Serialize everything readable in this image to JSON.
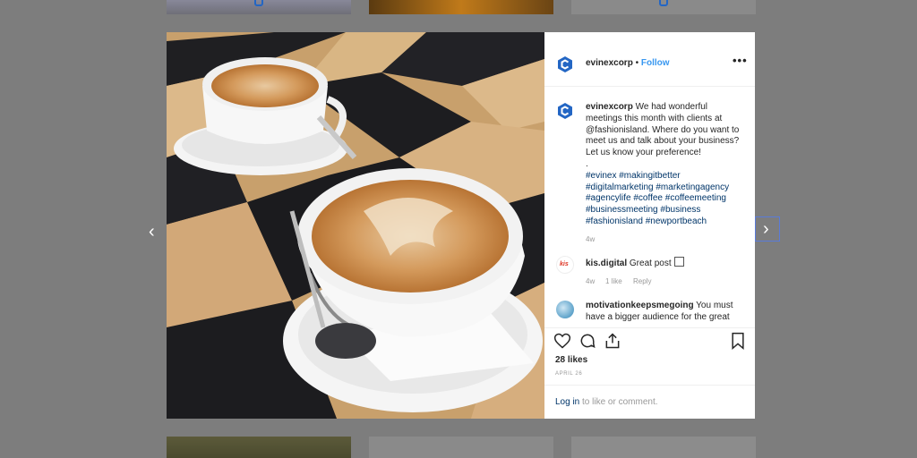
{
  "header": {
    "username": "evinexcorp",
    "separator": "•",
    "follow_label": "Follow",
    "more_icon": "more-options-icon"
  },
  "caption": {
    "username": "evinexcorp",
    "text": " We had wonderful meetings this month with clients at @fashionisland. Where do you want to meet us and talk about your business? Let us know your preference!\n.\n",
    "hashtags": "#evinex #makingitbetter #digitalmarketing #marketingagency #agencylife #coffee #coffeemeeting #businessmeeting #business #fashionisland #newportbeach",
    "age": "4w"
  },
  "comments": [
    {
      "username": "kis.digital",
      "text": " Great post",
      "age": "4w",
      "likes": "1 like",
      "reply_label": "Reply"
    },
    {
      "username": "motivationkeepsmegoing",
      "text": " You must have a bigger audience for the great"
    }
  ],
  "actions": {
    "icons": [
      "heart-icon",
      "comment-icon",
      "share-icon",
      "bookmark-icon"
    ]
  },
  "likes_text": "28 likes",
  "date_text": "APRIL 26",
  "login": {
    "link": "Log in",
    "text": " to like or comment."
  },
  "nav": {
    "prev_glyph": "‹",
    "next_glyph": "›"
  },
  "colors": {
    "brand": "#2366c4",
    "link": "#3897f0",
    "hashtag": "#003569",
    "overlay": "#7d7d7d"
  }
}
